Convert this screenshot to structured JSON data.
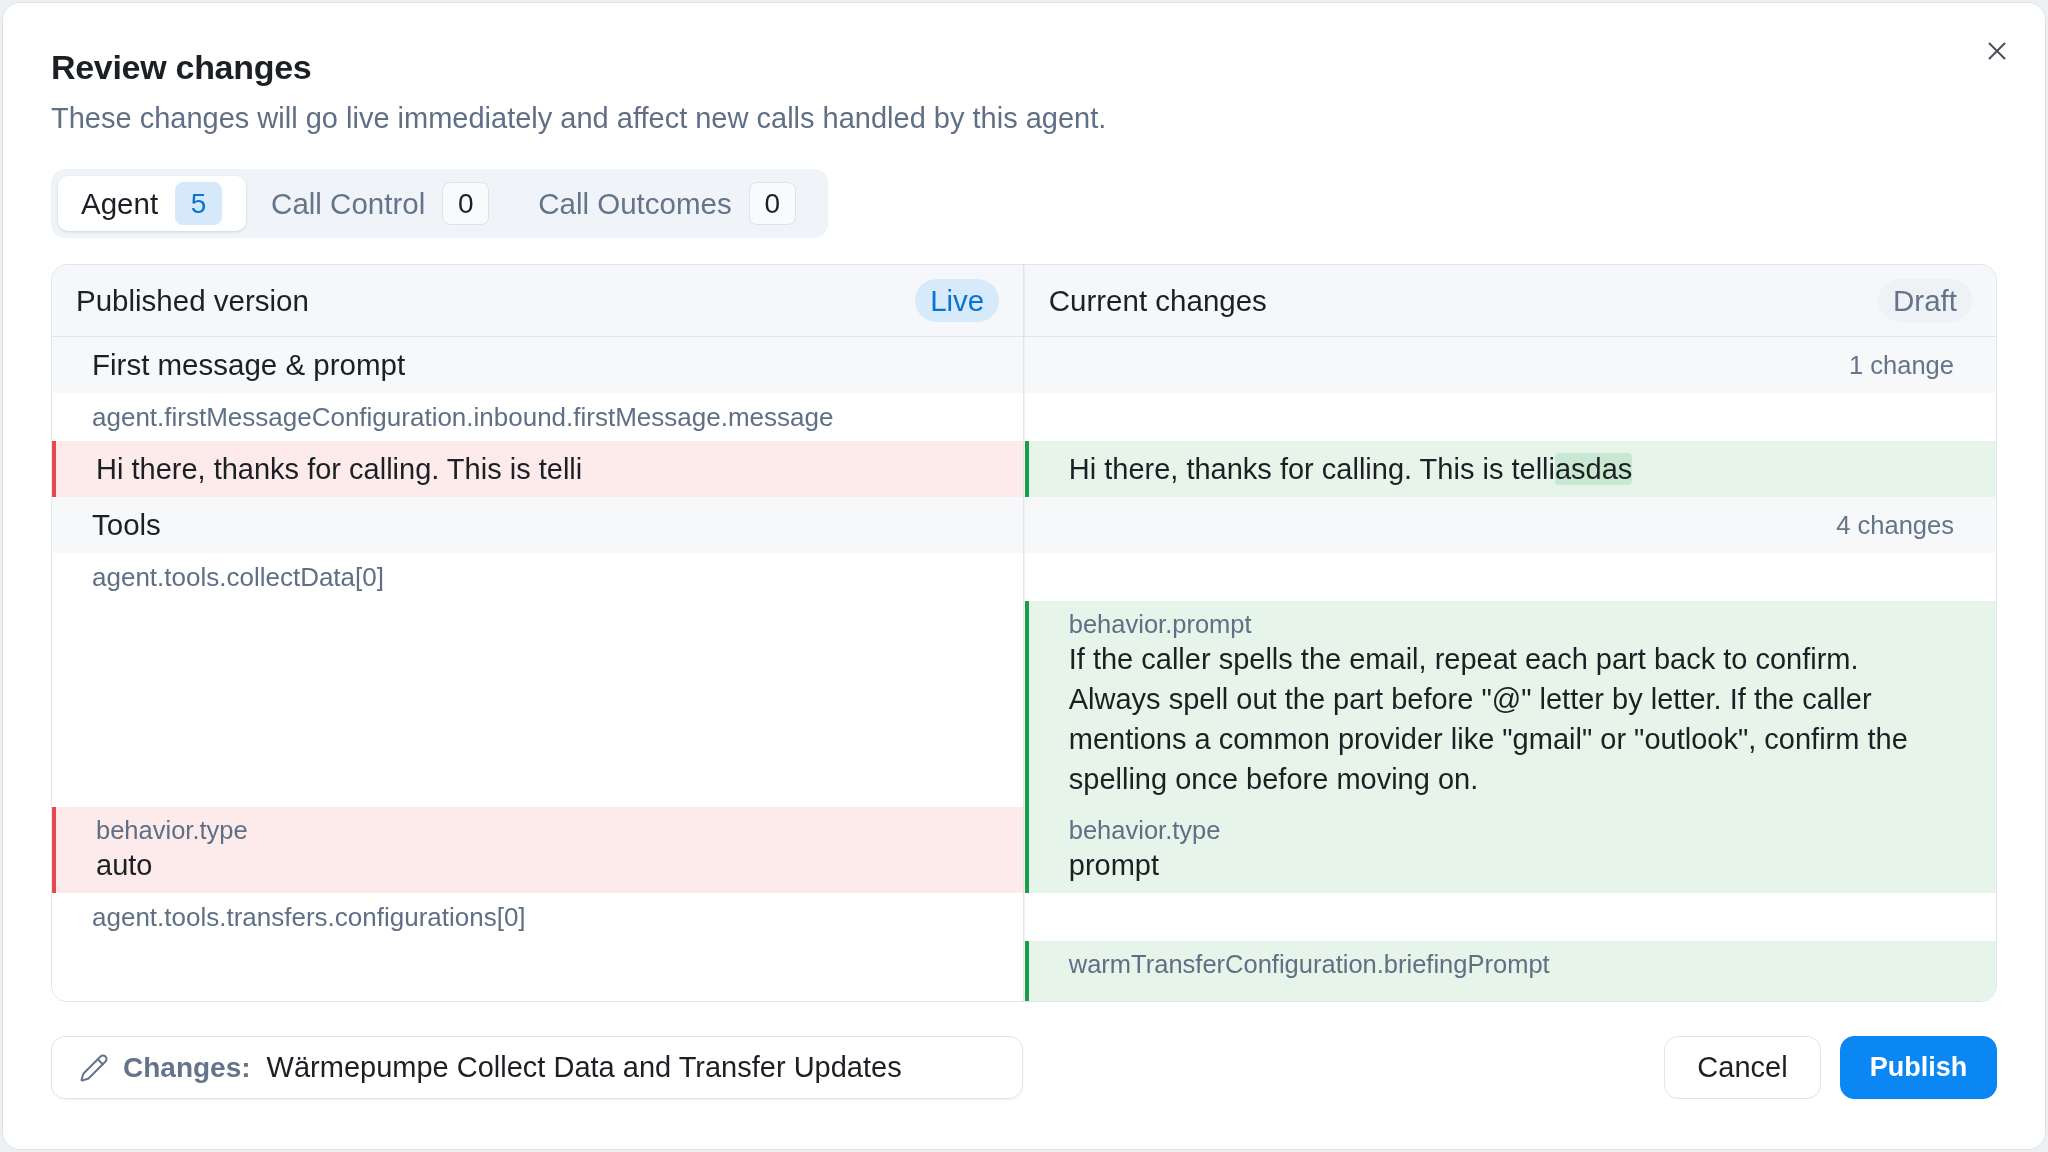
{
  "dialog": {
    "title": "Review changes",
    "subtitle": "These changes will go live immediately and affect new calls handled by this agent."
  },
  "tabs": [
    {
      "label": "Agent",
      "count": "5",
      "selected": true
    },
    {
      "label": "Call Control",
      "count": "0",
      "selected": false
    },
    {
      "label": "Call Outcomes",
      "count": "0",
      "selected": false
    }
  ],
  "diff": {
    "columns": [
      {
        "title": "Published version",
        "badge": "Live",
        "kind": "live"
      },
      {
        "title": "Current changes",
        "badge": "Draft",
        "kind": "draft"
      }
    ],
    "sections": [
      {
        "title": "First message & prompt",
        "changes": "1 change",
        "items": [
          {
            "path": "agent.firstMessageConfiguration.inbound.firstMessage.message",
            "rows": [
              {
                "before": {
                  "value": "Hi there, thanks for calling. This is telli"
                },
                "after": {
                  "value": "Hi there, thanks for calling. This is telli",
                  "inserted": "asdas"
                }
              }
            ]
          }
        ]
      },
      {
        "title": "Tools",
        "changes": "4 changes",
        "items": [
          {
            "path": "agent.tools.collectData[0]",
            "rows": [
              {
                "after": {
                  "field": "behavior.prompt",
                  "value": "If the caller spells the email, repeat each part back to confirm.\nAlways spell out the part before \"@\" letter by letter. If the caller\nmentions a common provider like \"gmail\" or \"outlook\", confirm the\nspelling once before moving on."
                }
              },
              {
                "before": {
                  "field": "behavior.type",
                  "value": "auto"
                },
                "after": {
                  "field": "behavior.type",
                  "value": "prompt"
                }
              }
            ]
          },
          {
            "path": "agent.tools.transfers.configurations[0]",
            "rows": [
              {
                "after": {
                  "field": "warmTransferConfiguration.briefingPrompt"
                }
              }
            ]
          }
        ]
      }
    ]
  },
  "footer": {
    "changes_field": {
      "label": "Changes:",
      "value": "Wärmepumpe Collect Data and Transfer Updates"
    },
    "buttons": [
      {
        "label": "Cancel",
        "kind": "secondary"
      },
      {
        "label": "Publish",
        "kind": "primary"
      }
    ]
  }
}
